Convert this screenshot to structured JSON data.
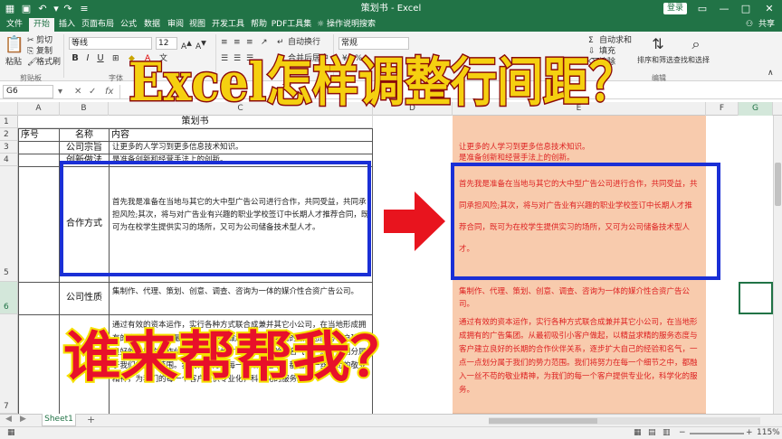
{
  "window": {
    "title": "策划书 - Excel",
    "login": "登录",
    "share": "共享",
    "minimize": "—",
    "restore": "□",
    "close": "✕"
  },
  "menu": {
    "tabs": [
      "文件",
      "开始",
      "插入",
      "页面布局",
      "公式",
      "数据",
      "审阅",
      "视图",
      "开发工具",
      "帮助",
      "PDF工具集"
    ],
    "active_tab": "开始",
    "tell_me": "操作说明搜索"
  },
  "ribbon": {
    "cut": "剪切",
    "copy": "复制",
    "format_painter": "格式刷",
    "paste": "粘贴",
    "clipboard_group": "剪贴板",
    "font_name": "等线",
    "font_size": "12",
    "bold": "B",
    "italic": "I",
    "underline": "U",
    "font_group": "字体",
    "wrap_text": "自动换行",
    "merge_center": "合并后居中",
    "number_format": "常规",
    "autosum": "自动求和",
    "fill": "填充",
    "clear": "清除",
    "sort_filter": "排序和筛选",
    "find_select": "查找和选择",
    "editing_group": "编辑"
  },
  "formula_bar": {
    "name_box": "G6",
    "fx": "fx"
  },
  "headline": "Excel怎样调整行间距？",
  "bottomline": "谁来帮帮我？",
  "columns": [
    "A",
    "B",
    "C",
    "D",
    "E",
    "F",
    "G"
  ],
  "rows": [
    "1",
    "2",
    "3",
    "4",
    "5",
    "6",
    "7"
  ],
  "sheet": {
    "title": "策划书",
    "header_no": "序号",
    "header_name": "名称",
    "header_content": "内容",
    "r3_name": "公司宗旨",
    "r3_content": "让更多的人学习到更多信息技术知识。",
    "r4_name": "创新做法",
    "r4_content": "是准备创新和经营手法上的创新。",
    "r5_name": "合作方式",
    "r5_content": "首先我是准备在当地与其它的大中型广告公司进行合作，共同受益，共同承担风险;其次，将与对广告业有兴趣的职业学校签订中长期人才推荐合同，既可为在校学生提供实习的场所，又可为公司储备技术型人才。",
    "r6_name": "公司性质",
    "r6_content": "集制作、代理、策划、创意、调查、咨询为一体的媒介性合资广告公司。",
    "r7_content": "通过有效的资本运作，实行各种方式联合成兼并其它小公司，在当地形成拥有的广告集团。从最初吸引小客户做起，以精益求精的服务态度与客户建立良好的长期的合作伙伴关系，逐步扩大自己的经验和名气，一点一点划分属于我们的势力范围。我们将努力在每一个细节之中，都融入一丝不苟的敬业精神，为我们的每一个客户提供专业化，科学化的服务。"
  },
  "right_panel": {
    "r3": "让更多的人学习到更多信息技术知识。",
    "r4": "是准备创新和经营手法上的创新。",
    "r5": "首先我是准备在当地与其它的大中型广告公司进行合作，共同受益，共同承担风险;其次，将与对广告业有兴趣的职业学校签订中长期人才推荐合同，既可为在校学生提供实习的场所，又可为公司储备技术型人才。",
    "r6": "集制作、代理、策划、创意、调查、咨询为一体的媒介性合资广告公司。",
    "r7": "通过有效的资本运作，实行各种方式联合成兼并其它小公司，在当地形成拥有的广告集团。从最初吸引小客户做起，以精益求精的服务态度与客户建立良好的长期的合作伙伴关系，逐步扩大自己的经验和名气，一点一点划分属于我们的势力范围。我们将努力在每一个细节之中，都融入一丝不苟的敬业精神，为我们的每一个客户提供专业化，科学化的服务。"
  },
  "sheet_tab": "Sheet1",
  "add_sheet": "+",
  "zoom": "115%",
  "colors": {
    "excel_green": "#217346",
    "headline_fill": "#f5d010",
    "headline_stroke": "#8a0a0a",
    "bottom_fill": "#e8102a",
    "bottom_stroke": "#f5e000",
    "box_blue": "#1a2fd6",
    "arrow_red": "#e8141e",
    "panel_fill": "#f8cbad"
  }
}
